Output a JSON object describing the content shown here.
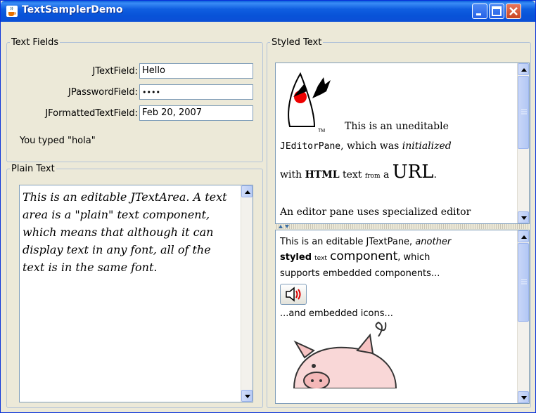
{
  "window": {
    "title": "TextSamplerDemo"
  },
  "text_fields": {
    "legend": "Text Fields",
    "rows": [
      {
        "label": "JTextField:",
        "value": "Hello"
      },
      {
        "label": "JPasswordField:",
        "value": "••••"
      },
      {
        "label": "JFormattedTextField:",
        "value": "Feb 20, 2007"
      }
    ],
    "status": "You typed \"hola\""
  },
  "plain_text": {
    "legend": "Plain Text",
    "content": "This is an editable JTextArea. A text area is a \"plain\" text component, which means that although it can display text in any font, all of the text is in the same font."
  },
  "styled_text": {
    "legend": "Styled Text",
    "editor": {
      "p1": "This is an uneditable",
      "code": "JEditorPane",
      "p2": ", which was ",
      "em": "initialized",
      "p3": "with ",
      "bold": "HTML",
      "p4": " text ",
      "small": "from",
      "p5": " a ",
      "big": "URL",
      "p6": ".",
      "p7": "An editor pane uses specialized editor"
    },
    "pane": {
      "line1a": "This is an editable JTextPane, ",
      "line1b": "another",
      "bold": "styled",
      "small": "text",
      "big": "component",
      "line2b": ", which",
      "line3": "supports embedded components...",
      "line4": "...and embedded icons..."
    }
  },
  "icons": {
    "app": "java-cup-icon",
    "sound": "speaker-icon"
  }
}
